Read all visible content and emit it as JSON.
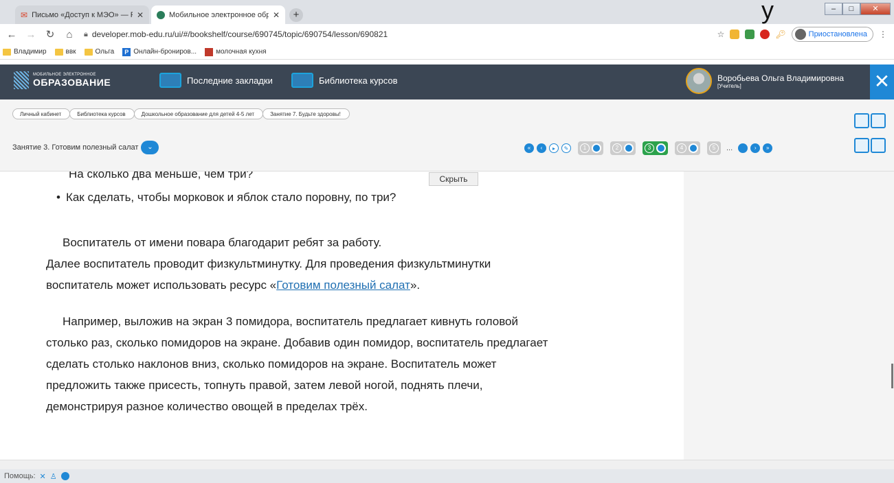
{
  "browser": {
    "tabs": [
      {
        "title": "Письмо «Доступ к МЭО» — Ро",
        "close": "✕"
      },
      {
        "title": "Мобильное электронное обра",
        "close": "✕"
      }
    ],
    "new_tab": "+",
    "url": "developer.mob-edu.ru/ui/#/bookshelf/course/690745/topic/690754/lesson/690821",
    "profile_status": "Приостановлена",
    "bookmarks": [
      "Владимир",
      "ввк",
      "Ольга",
      "Онлайн-брониров...",
      "молочная кухня"
    ],
    "overlay_glyph": "у"
  },
  "app": {
    "logo_small": "МОБИЛЬНОЕ ЭЛЕКТРОННОЕ",
    "logo_big": "ОБРАЗОВАНИЕ",
    "nav": [
      "Последние закладки",
      "Библиотека курсов"
    ],
    "user_name": "Воробьева Ольга Владимировна",
    "user_role": "[Учитель]",
    "close_glyph": "✕"
  },
  "breadcrumbs": [
    "Личный кабинет",
    "Библиотека курсов",
    "Дошкольное образование для детей 4-5 лет",
    "Занятие 7. Будьте здоровы!"
  ],
  "lesson_select": "Занятие 3. Готовим полезный салат",
  "pager": {
    "pages": [
      "1",
      "2",
      "3",
      "4",
      "5"
    ],
    "active": "3",
    "ellipsis": "..."
  },
  "content": {
    "hide_button": "Скрыть",
    "cut_line": "На сколько два меньше, чем три?",
    "bullet": "Как сделать, чтобы морковок и яблок стало поровну, по три?",
    "p1_line1": "Воспитатель от имени повара благодарит ребят за работу.",
    "p1_line2": "Далее воспитатель проводит физкультминутку. Для проведения физкультминутки",
    "p1_line3_pre": "воспитатель может использовать ресурс «",
    "p1_link": "Готовим полезный салат",
    "p1_line3_post": "».",
    "p2": [
      "Например, выложив на экран 3 помидора, воспитатель предлагает кивнуть головой",
      "столько раз, сколько помидоров на экране. Добавив один помидор, воспитатель предлагает",
      "сделать столько наклонов вниз, сколько помидоров на экране. Воспитатель может",
      "предложить также присесть, топнуть правой, затем левой ногой, поднять плечи,",
      "демонстрируя разное количество овощей в пределах трёх."
    ]
  },
  "status_bar": {
    "help": "Помощь:"
  }
}
